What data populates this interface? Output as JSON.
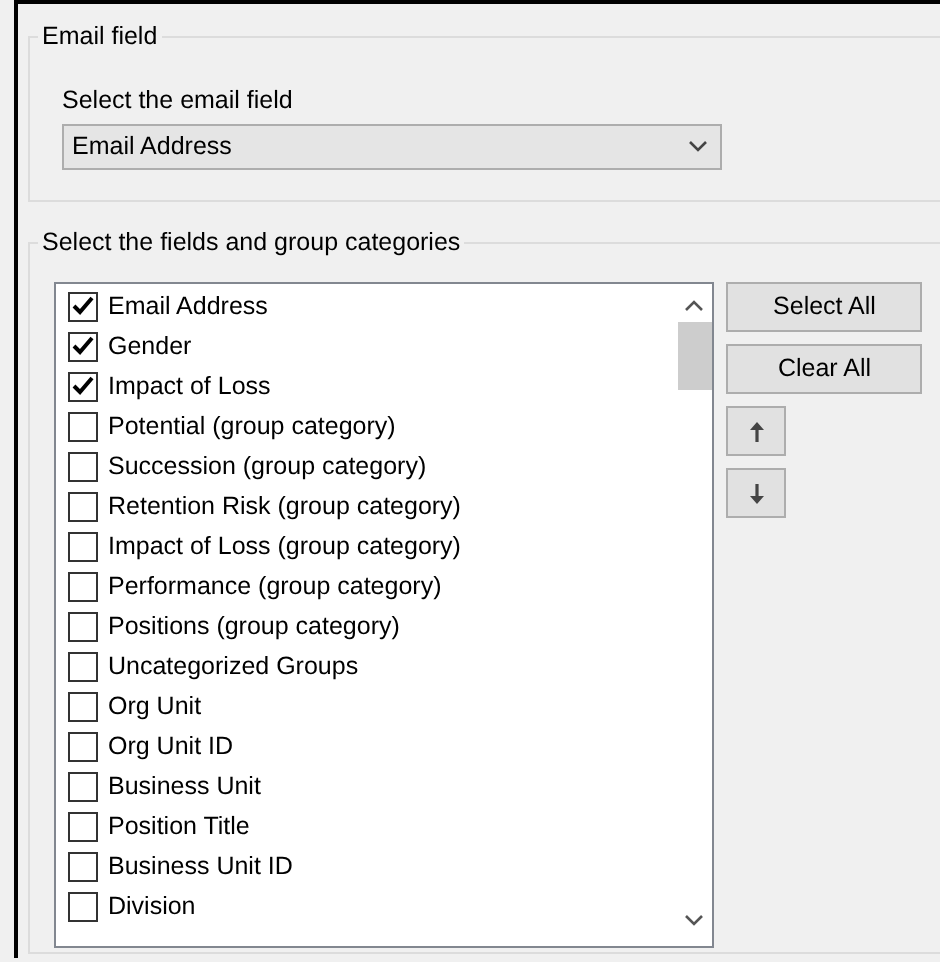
{
  "email_group": {
    "title": "Email field",
    "label": "Select the email field",
    "dropdown": {
      "value": "Email Address"
    }
  },
  "fields_group": {
    "title": "Select the fields and group categories",
    "items": [
      {
        "label": "Email Address",
        "checked": true
      },
      {
        "label": "Gender",
        "checked": true
      },
      {
        "label": "Impact of Loss",
        "checked": true
      },
      {
        "label": "Potential (group category)",
        "checked": false
      },
      {
        "label": "Succession (group category)",
        "checked": false
      },
      {
        "label": "Retention Risk (group category)",
        "checked": false
      },
      {
        "label": "Impact of Loss (group category)",
        "checked": false
      },
      {
        "label": "Performance (group category)",
        "checked": false
      },
      {
        "label": "Positions (group category)",
        "checked": false
      },
      {
        "label": "Uncategorized Groups",
        "checked": false
      },
      {
        "label": "Org Unit",
        "checked": false
      },
      {
        "label": "Org Unit ID",
        "checked": false
      },
      {
        "label": "Business Unit",
        "checked": false
      },
      {
        "label": "Position Title",
        "checked": false
      },
      {
        "label": "Business Unit ID",
        "checked": false
      },
      {
        "label": "Division",
        "checked": false
      }
    ],
    "buttons": [
      {
        "kind": "text",
        "label": "Select All"
      },
      {
        "kind": "text",
        "label": "Clear All"
      },
      {
        "kind": "up"
      },
      {
        "kind": "down"
      }
    ]
  }
}
